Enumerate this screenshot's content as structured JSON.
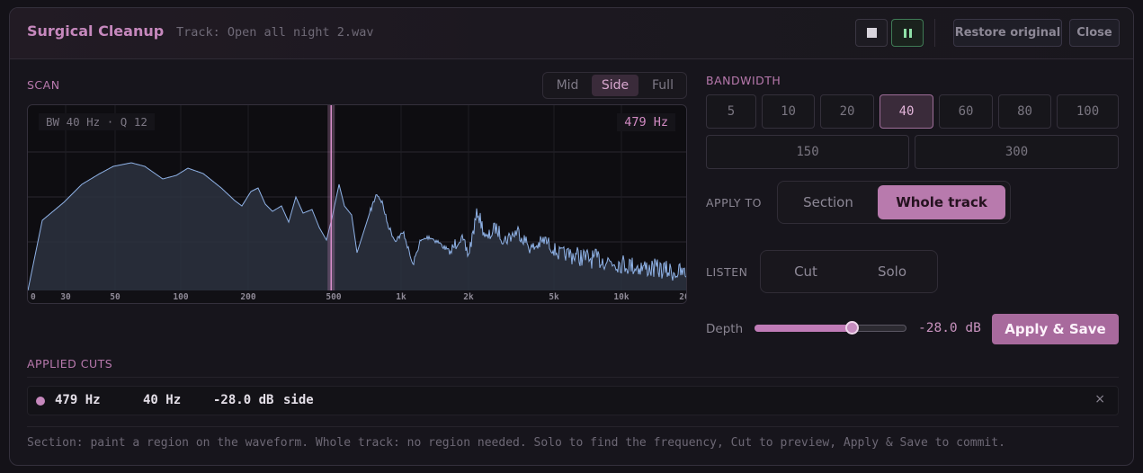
{
  "header": {
    "title": "Surgical Cleanup",
    "track": "Track: Open all night 2.wav",
    "stop_icon": "stop-icon",
    "pause_icon": "pause-icon",
    "restore_label": "Restore original",
    "close_label": "Close"
  },
  "scan": {
    "label": "SCAN",
    "modes": [
      "Mid",
      "Side",
      "Full"
    ],
    "selected_mode": "Side",
    "bw_badge": "BW 40 Hz · Q 12",
    "hz_badge": "479 Hz",
    "ticks": [
      "0",
      "30",
      "50",
      "100",
      "200",
      "500",
      "1k",
      "2k",
      "5k",
      "10k",
      "20"
    ],
    "selected_freq_hz": 479
  },
  "bandwidth": {
    "label": "BANDWIDTH",
    "options": [
      "5",
      "10",
      "20",
      "40",
      "60",
      "80",
      "100",
      "150",
      "300"
    ],
    "selected": "40"
  },
  "apply_to": {
    "label": "APPLY TO",
    "options": [
      "Section",
      "Whole track"
    ],
    "selected": "Whole track"
  },
  "listen": {
    "label": "LISTEN",
    "options": [
      "Cut",
      "Solo"
    ]
  },
  "depth": {
    "label": "Depth",
    "value_text": "-28.0 dB",
    "fraction": 0.64
  },
  "apply_save_label": "Apply & Save",
  "applied_cuts": {
    "label": "APPLIED CUTS",
    "items": [
      {
        "freq": "479 Hz",
        "bw": "40 Hz",
        "depth": "-28.0 dB",
        "channel": "side",
        "remove_label": "×"
      }
    ]
  },
  "hint": "Section: paint a region on the waveform. Whole track: no region needed. Solo to find the frequency, Cut to preview, Apply & Save to commit.",
  "colors": {
    "accent": "#c688bd",
    "spectrum_line": "#8fb2e6",
    "spectrum_fill": "#2b3340"
  }
}
